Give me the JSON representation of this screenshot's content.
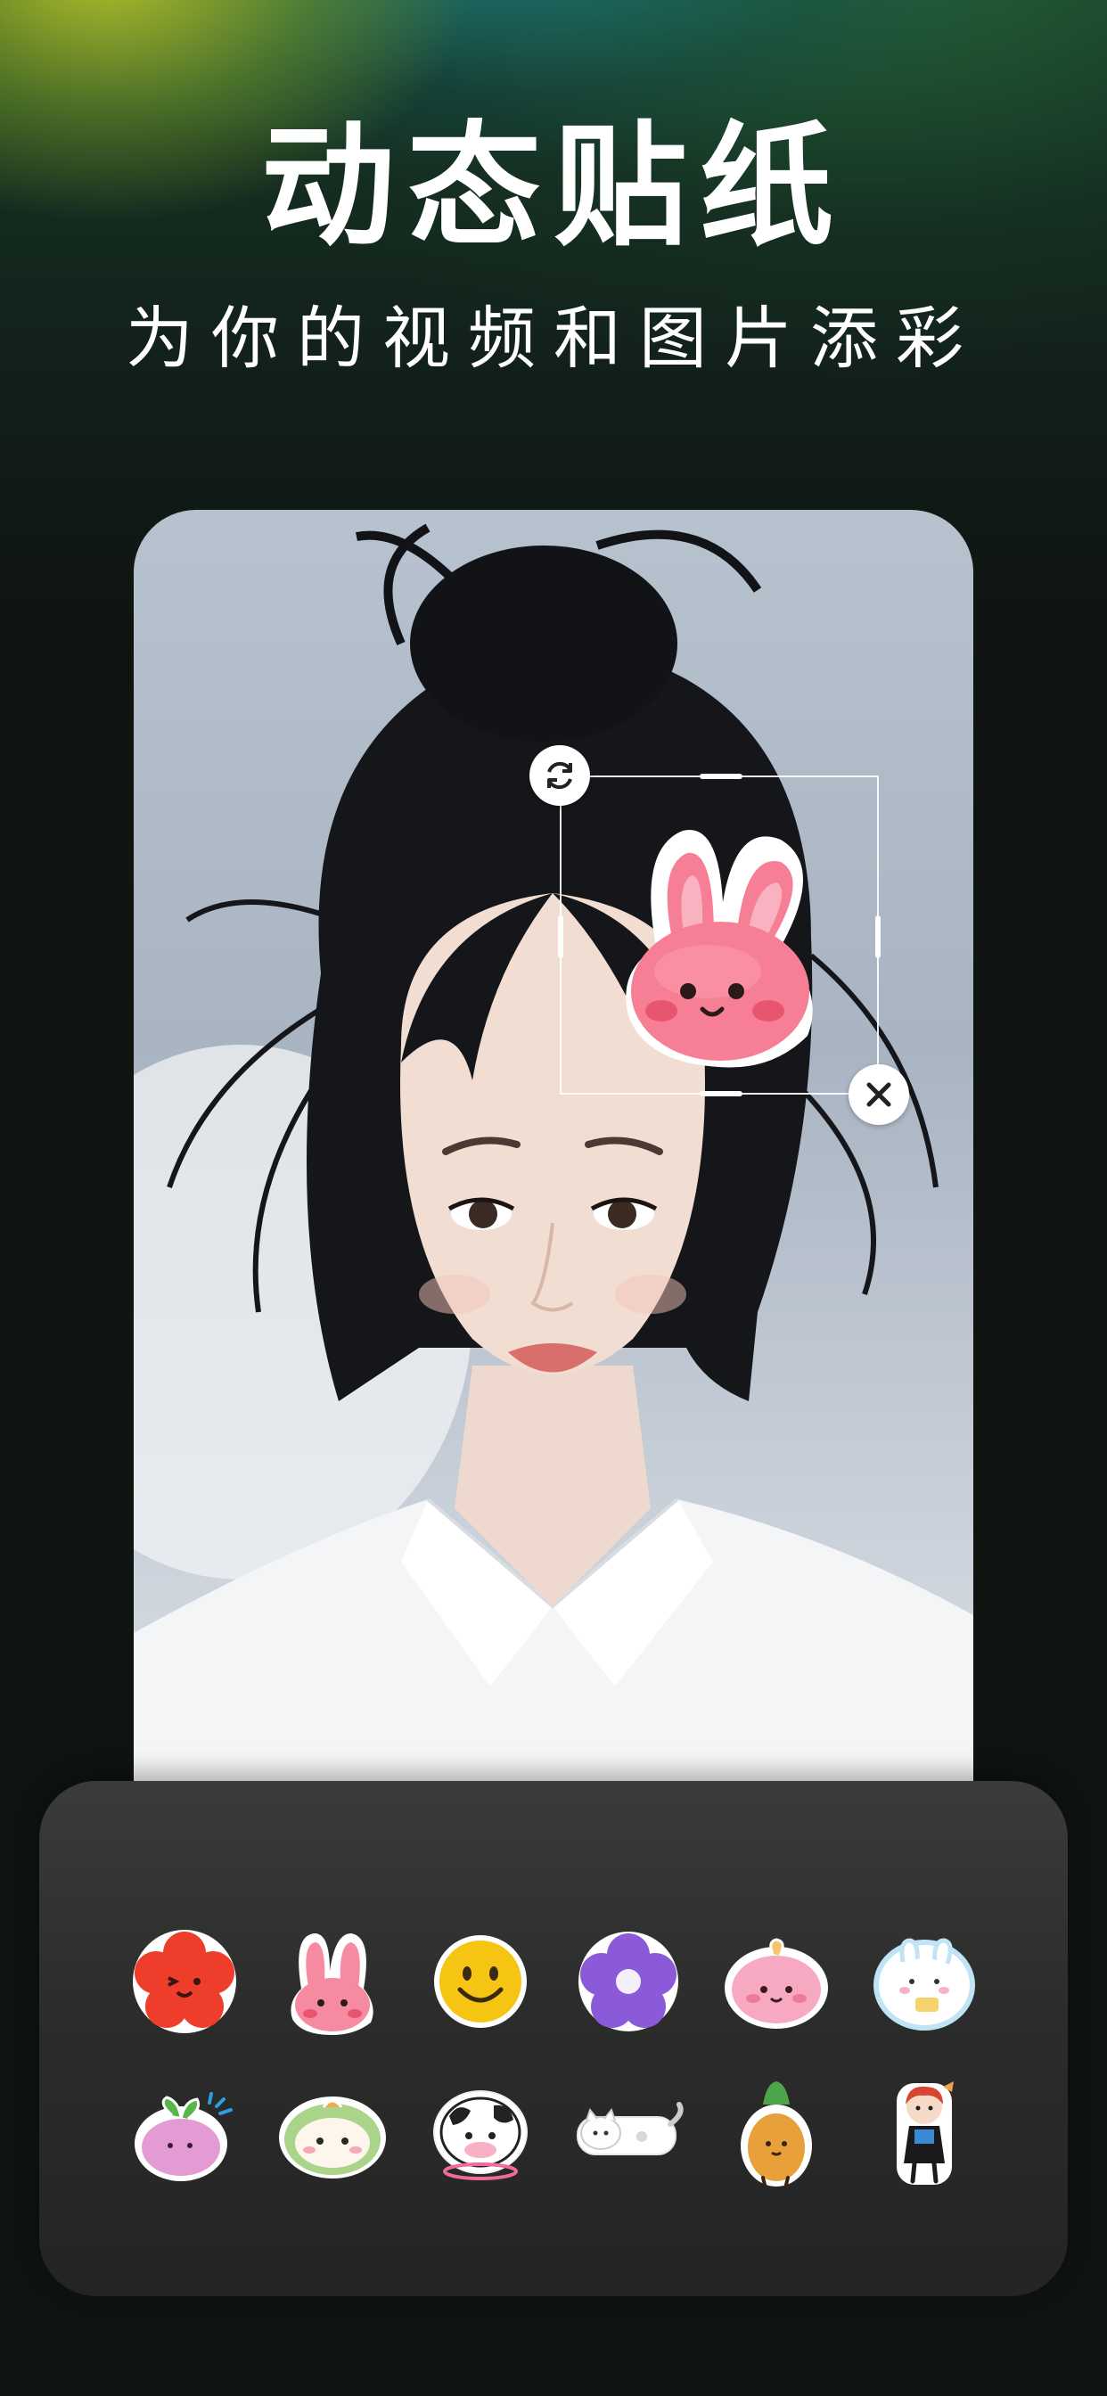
{
  "header": {
    "title": "动态贴纸",
    "subtitle": "为你的视频和图片添彩"
  },
  "editor": {
    "active_sticker": "pink-bunny-sticker",
    "rotate_icon": "rotate-icon",
    "delete_icon": "close-icon"
  },
  "sticker_panel": {
    "stickers": [
      {
        "name": "red-flower-face-sticker"
      },
      {
        "name": "pink-bunny-sticker"
      },
      {
        "name": "smiley-face-sticker"
      },
      {
        "name": "purple-flower-sticker"
      },
      {
        "name": "pink-blob-sticker"
      },
      {
        "name": "blue-bunny-sticker"
      },
      {
        "name": "pink-radish-sticker"
      },
      {
        "name": "green-frog-sticker"
      },
      {
        "name": "cow-sticker"
      },
      {
        "name": "white-cat-sticker"
      },
      {
        "name": "pineapple-sticker"
      },
      {
        "name": "girl-character-sticker"
      }
    ]
  },
  "colors": {
    "accent_green": "#163826",
    "panel_bg": "#2b2c2b",
    "bunny_pink": "#f77f95"
  }
}
